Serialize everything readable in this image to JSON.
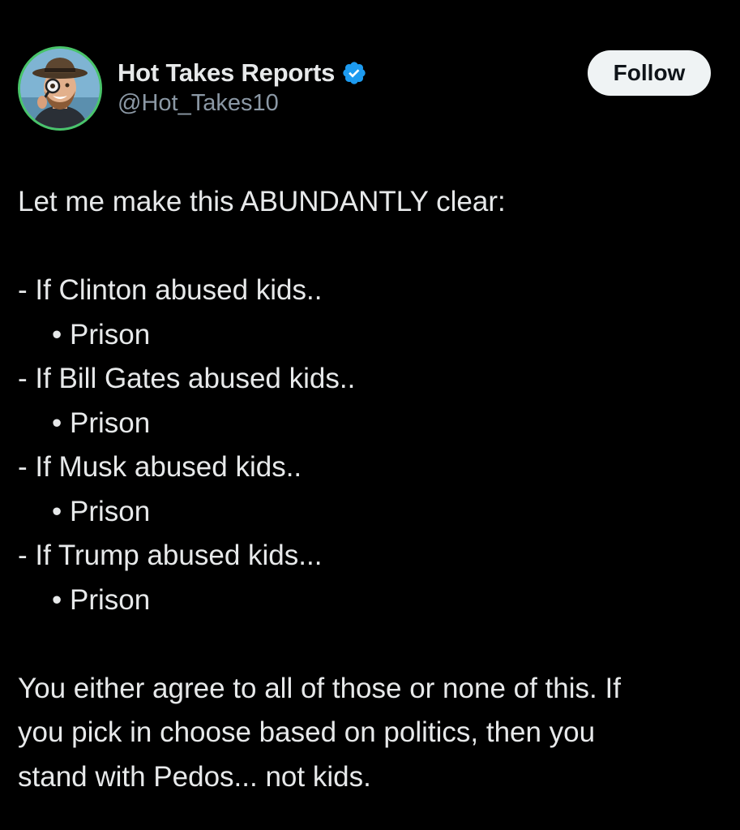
{
  "colors": {
    "background": "#000000",
    "text": "#e7e9ea",
    "handle": "#8b98a5",
    "verified_badge": "#1d9bf0",
    "follow_button_bg": "#eff3f4",
    "follow_button_text": "#0f1419",
    "avatar_ring": "#49c46a"
  },
  "author": {
    "display_name": "Hot Takes Reports",
    "handle": "@Hot_Takes10",
    "verified": true,
    "avatar_icon": "profile-photo-man-with-hat"
  },
  "follow_button": {
    "label": "Follow"
  },
  "post": {
    "intro": "Let me make this ABUNDANTLY clear:",
    "items": [
      {
        "condition": "- If Clinton abused kids..",
        "result": "• Prison"
      },
      {
        "condition": "- If Bill Gates abused kids..",
        "result": "• Prison"
      },
      {
        "condition": "- If Musk abused kids..",
        "result": "• Prison"
      },
      {
        "condition": "- If Trump abused kids...",
        "result": "• Prison"
      }
    ],
    "closing_lines": [
      "You either agree to all of those or none of this. If",
      "you pick in choose based on politics, then you",
      "stand with Pedos... not kids."
    ]
  }
}
